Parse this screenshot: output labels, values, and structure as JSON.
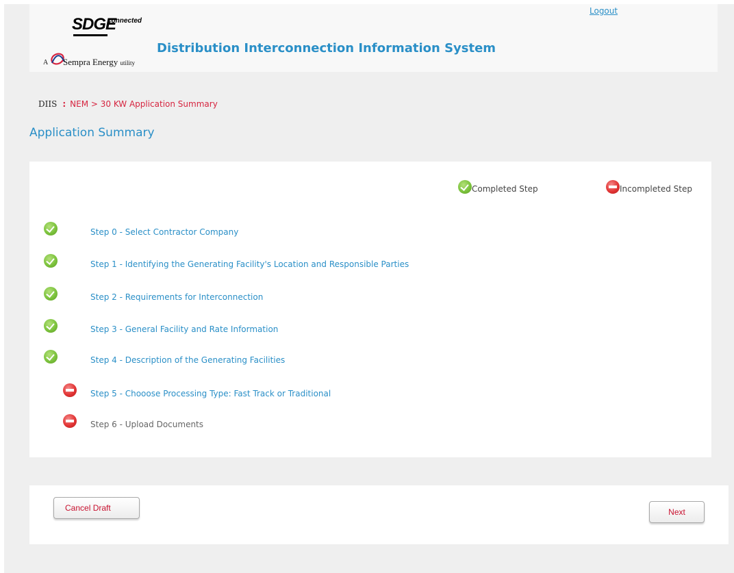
{
  "header": {
    "brand": {
      "logo_text": "SDGE",
      "logo_superscript": "connected",
      "tagline_prefix": "A",
      "tagline": "Sempra Energy",
      "tagline_suffix": "utility"
    },
    "app_title": "Distribution Interconnection Information System",
    "logout_label": "Logout"
  },
  "breadcrumb": {
    "root": "DIIS",
    "separator": ":",
    "current": "NEM > 30 KW Application Summary"
  },
  "page_title": "Application Summary",
  "legend": {
    "completed_label": "Completed Step",
    "incompleted_label": "Incompleted Step"
  },
  "steps": [
    {
      "label": "Step 0 - Select Contractor Company",
      "status": "completed"
    },
    {
      "label": "Step 1 - Identifying the Generating Facility's Location and Responsible Parties",
      "status": "completed"
    },
    {
      "label": "Step 2 - Requirements for Interconnection",
      "status": "completed"
    },
    {
      "label": "Step 3 - General Facility and Rate Information",
      "status": "completed"
    },
    {
      "label": "Step 4 - Description of the Generating Facilities",
      "status": "completed"
    },
    {
      "label": "Step 5 - Chooose Processing Type: Fast Track or Traditional",
      "status": "incompleted"
    },
    {
      "label": "Step 6 - Upload Documents",
      "status": "incompleted"
    }
  ],
  "buttons": {
    "cancel_draft": "Cancel Draft",
    "next": "Next"
  },
  "colors": {
    "accent_blue": "#2a8fc7",
    "breadcrumb_red": "#d6243f",
    "button_text_red": "#c8102e",
    "completed_green": "#7cc33d",
    "incompleted_red": "#e23535"
  }
}
